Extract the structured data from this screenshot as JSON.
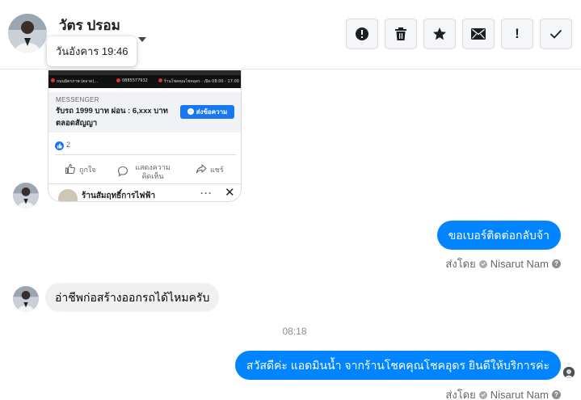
{
  "header": {
    "contact_name": "วัตร ปรอม",
    "tooltip_time": "วันอังคาร 19:46",
    "actions": [
      {
        "name": "report",
        "icon": "alert-circle-icon"
      },
      {
        "name": "delete",
        "icon": "trash-icon"
      },
      {
        "name": "star",
        "icon": "star-icon"
      },
      {
        "name": "mark-unread",
        "icon": "envelope-icon"
      },
      {
        "name": "important",
        "icon": "exclamation-icon",
        "label": "!"
      },
      {
        "name": "mark-done",
        "icon": "checkmark-icon"
      }
    ]
  },
  "shared_post": {
    "source": "MESSENGER",
    "description": "รับรถ 1999 บาท ผ่อน : 6,xxx บาท ตลอดสัญญา",
    "cta_label": "ส่งข้อความ",
    "like_count": "2",
    "actions": {
      "like": "ถูกใจ",
      "comment": "แสดงความคิดเห็น",
      "share": "แชร์"
    },
    "comment_author": "ร้านสัมฤทธิ์การไฟฟ้า",
    "banner_texts": [
      "ถนนมิตรภาพ (ตลาด)...",
      "0885577932",
      "ร้านโชคคุณโชคอุดร · เปิด 08:00 - 17:00"
    ]
  },
  "messages": [
    {
      "direction": "outgoing",
      "text": "ขอเบอร์ติดต่อกลับจ้า",
      "sent_by_label": "ส่งโดย",
      "sender": "Nisarut Nam"
    },
    {
      "direction": "incoming",
      "text": "อ่าชีพก่อสร้างออกรถได้ไหมครับ"
    },
    {
      "direction": "outgoing",
      "text": "สวัสดีค่ะ แอดมินน้ำ จากร้านโชคคุณโชคอุดร ยินดีให้บริการค่ะ",
      "sent_by_label": "ส่งโดย",
      "sender": "Nisarut Nam"
    }
  ],
  "timestamp": "08:18",
  "colors": {
    "outgoing_bubble": "#0084ff",
    "incoming_bubble": "#f0f0f0",
    "accent": "#1877f2"
  }
}
